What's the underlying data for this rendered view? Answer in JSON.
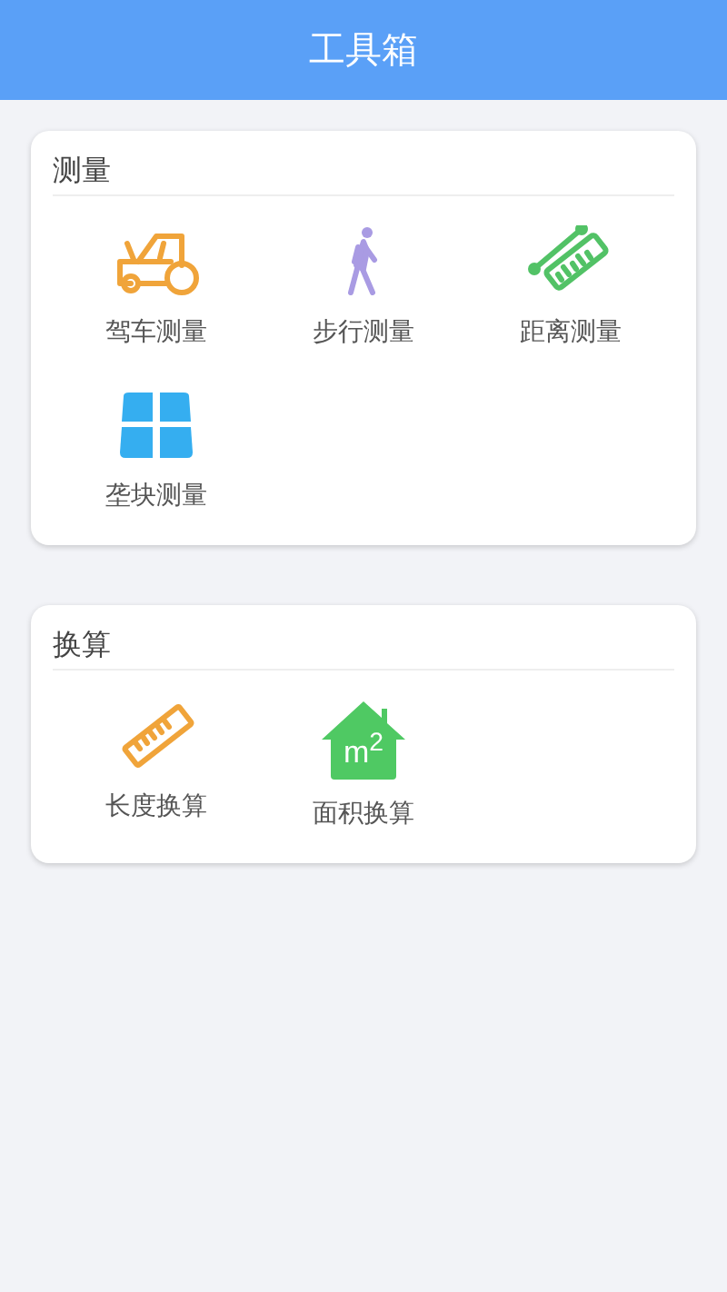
{
  "header": {
    "title": "工具箱"
  },
  "sections": [
    {
      "title": "测量",
      "tools": [
        {
          "label": "驾车测量"
        },
        {
          "label": "步行测量"
        },
        {
          "label": "距离测量"
        },
        {
          "label": "垄块测量"
        }
      ]
    },
    {
      "title": "换算",
      "tools": [
        {
          "label": "长度换算"
        },
        {
          "label": "面积换算",
          "icon_text": "m$^{2}$"
        }
      ]
    }
  ]
}
